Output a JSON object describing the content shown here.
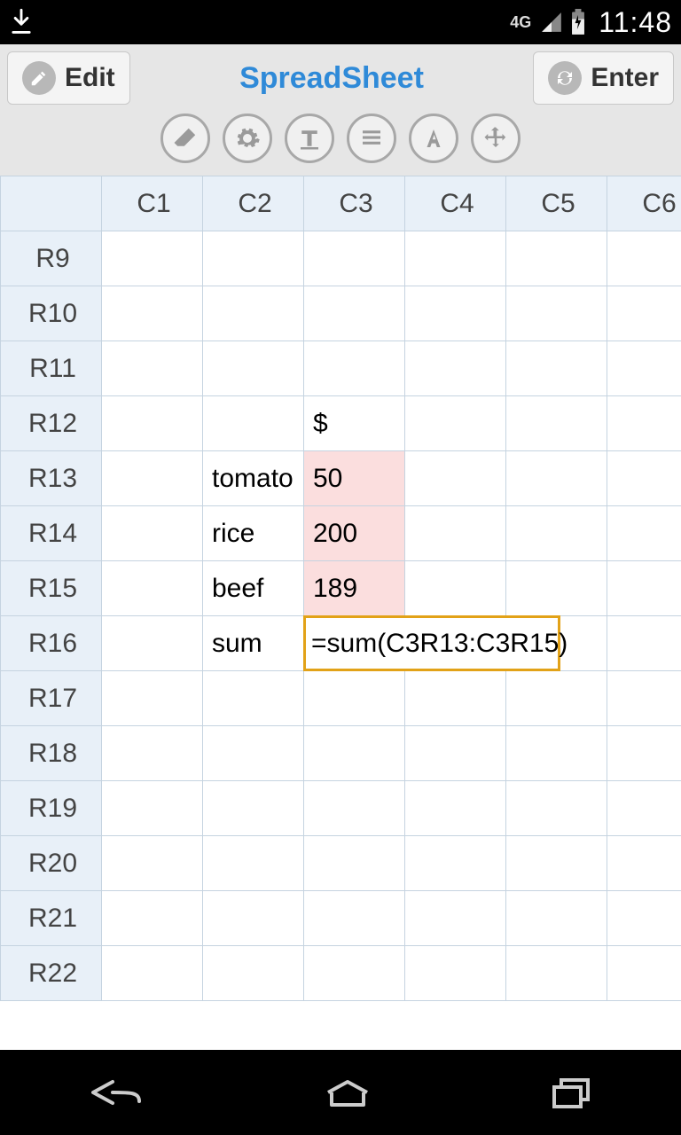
{
  "status": {
    "network": "4G",
    "clock": "11:48"
  },
  "header": {
    "edit_label": "Edit",
    "title": "SpreadSheet",
    "enter_label": "Enter"
  },
  "columns": [
    "C1",
    "C2",
    "C3",
    "C4",
    "C5",
    "C6"
  ],
  "rows": [
    "R9",
    "R10",
    "R11",
    "R12",
    "R13",
    "R14",
    "R15",
    "R16",
    "R17",
    "R18",
    "R19",
    "R20",
    "R21",
    "R22"
  ],
  "cells": {
    "R12": {
      "C3": "$"
    },
    "R13": {
      "C2": "tomato",
      "C3": "50"
    },
    "R14": {
      "C2": "rice",
      "C3": "200"
    },
    "R15": {
      "C2": "beef",
      "C3": "189"
    },
    "R16": {
      "C2": "sum",
      "C3": "=sum(C3R13:C3R15)"
    }
  },
  "highlighted_pink": [
    "R13.C3",
    "R14.C3",
    "R15.C3"
  ],
  "active_cell": "R16.C3"
}
